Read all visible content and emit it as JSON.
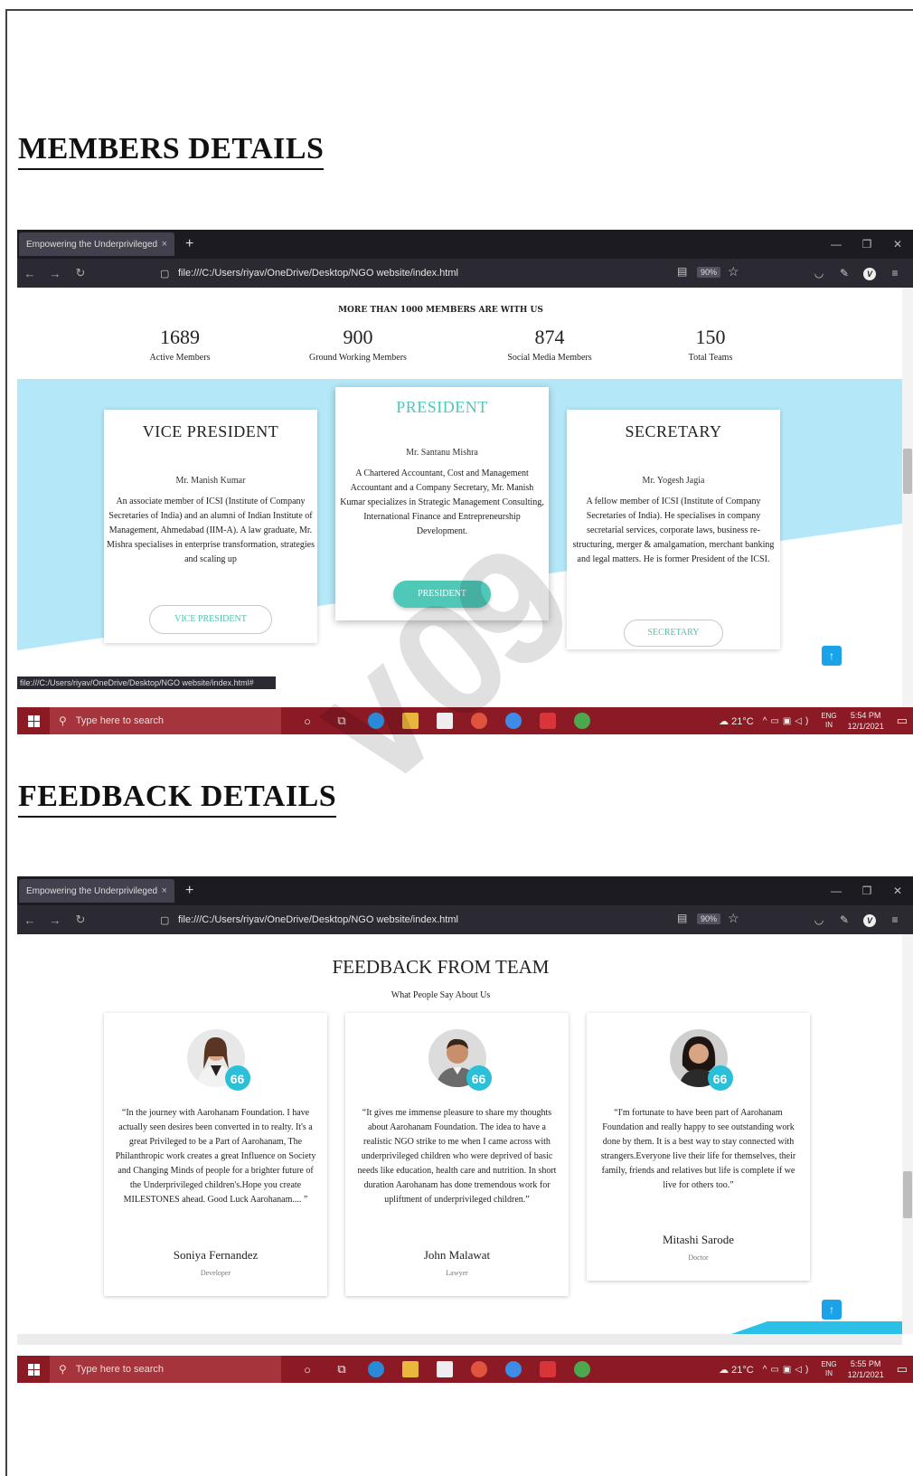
{
  "headings": {
    "members": "MEMBERS DETAILS",
    "feedback": "FEEDBACK DETAILS"
  },
  "browser": {
    "tab_title": "Empowering the Underprivileged",
    "tab_close": "×",
    "new_tab": "+",
    "url": "file:///C:/Users/riyav/OneDrive/Desktop/NGO website/index.html",
    "zoom": "90%",
    "status_url": "file:///C:/Users/riyav/OneDrive/Desktop/NGO website/index.html#"
  },
  "taskbar": {
    "search_placeholder": "Type here to search",
    "weather": "21°C",
    "lang_top": "ENG",
    "lang_bottom": "IN",
    "time_1": "5:54 PM",
    "time_2": "5:55 PM",
    "date": "12/1/2021"
  },
  "members": {
    "title": "MORE THAN 1000 MEMBERS ARE WITH US",
    "stats": [
      {
        "num": "1689",
        "label": "Active Members"
      },
      {
        "num": "900",
        "label": "Ground Working Members"
      },
      {
        "num": "874",
        "label": "Social Media Members"
      },
      {
        "num": "150",
        "label": "Total Teams"
      }
    ],
    "cards": {
      "vice": {
        "role": "VICE PRESIDENT",
        "name": "Mr. Manish Kumar",
        "desc": "An associate member of ICSI (Institute of Company Secretaries of India) and an alumni of Indian Institute of Management, Ahmedabad (IIM-A). A law graduate, Mr. Mishra specialises in enterprise transformation, strategies and scaling up",
        "button": "VICE PRESIDENT"
      },
      "president": {
        "role": "PRESIDENT",
        "name": "Mr. Santanu Mishra",
        "desc": "A Chartered Accountant, Cost and Management Accountant and a Company Secretary, Mr. Manish Kumar specializes in Strategic Management Consulting, International Finance and Entrepreneurship Development.",
        "button": "PRESIDENT"
      },
      "secretary": {
        "role": "SECRETARY",
        "name": "Mr. Yogesh Jagia",
        "desc": "A fellow member of ICSI (Institute of Company Secretaries of India). He specialises in company secretarial services, corporate laws, business re-structuring, merger & amalgamation, merchant banking and legal matters. He is former President of the ICSI.",
        "button": "SECRETARY"
      }
    }
  },
  "feedback": {
    "title": "FEEDBACK FROM TEAM",
    "subtitle": "What People Say About Us",
    "items": [
      {
        "text": "“In the journey with Aarohanam Foundation. I have actually seen desires been converted in to realty. It's a great Privileged to be a Part of Aarohanam, The Philanthropic work creates a great Influence on Society and Changing Minds of people for a brighter future of the Underprivileged children's.Hope you create MILESTONES ahead. Good Luck Aarohanam.... ”",
        "name": "Soniya Fernandez",
        "role": "Developer"
      },
      {
        "text": "“It gives me immense pleasure to share my thoughts about Aarohanam Foundation. The idea to have a realistic NGO strike to me when I came across with underprivileged children who were deprived of basic needs like education, health care and nutrition. In short duration Aarohanam has done tremendous work for upliftment of underprivileged children.”",
        "name": "John Malawat",
        "role": "Lawyer"
      },
      {
        "text": "“I'm fortunate to have been part of Aarohanam Foundation and really happy to see outstanding work done by them. It is a best way to stay connected with strangers.Everyone live their life for themselves, their family, friends and relatives but life is complete if we live for others too.”",
        "name": "Mitashi Sarode",
        "role": "Doctor"
      }
    ]
  },
  "icons": {
    "quote": "66",
    "up": "↑"
  },
  "colors": {
    "accent_teal": "#4fc8b8",
    "cyan_band": "#b4e7f7",
    "taskbar": "#8b1a24",
    "scroll_top": "#1aa3e8"
  }
}
